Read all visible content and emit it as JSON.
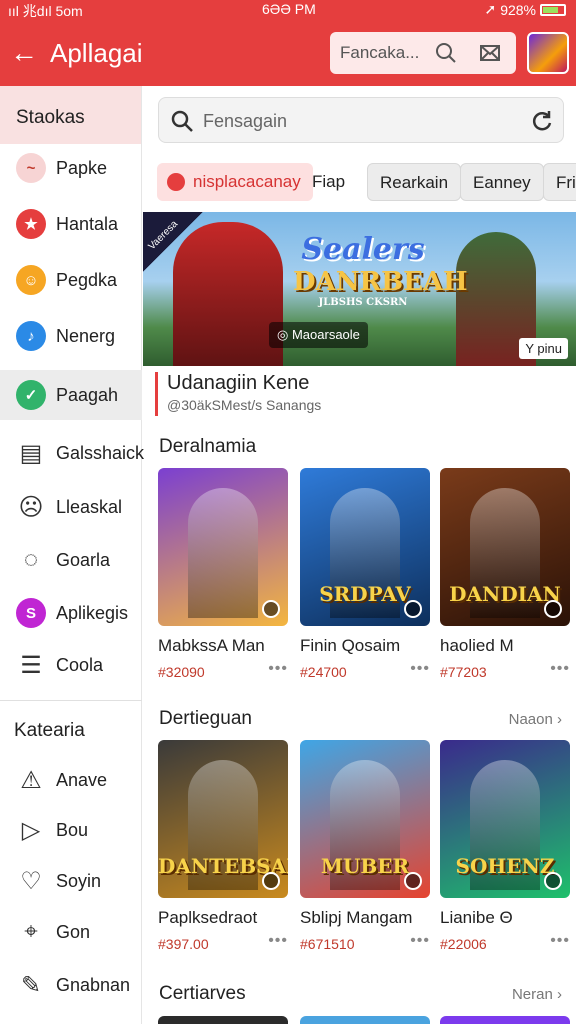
{
  "status_bar": {
    "left": "ııl 兆dıl 5om",
    "time": "6ƏƏ PM",
    "battery": "928%"
  },
  "header": {
    "title": "Apllagai",
    "search_text": "Fancaka..."
  },
  "sidebar": {
    "heading": "Staokas",
    "items": [
      {
        "label": "Papke",
        "icon": "swirl-icon",
        "color": "#f7d4d4",
        "glyph": "~"
      },
      {
        "label": "Hantala",
        "icon": "star-icon",
        "color": "#e53e3e",
        "glyph": "★"
      },
      {
        "label": "Pegdka",
        "icon": "face-icon",
        "color": "#f6a623",
        "glyph": "☺"
      },
      {
        "label": "Nenerg",
        "icon": "note-icon",
        "color": "#2b8ae6",
        "glyph": "♪"
      },
      {
        "label": "Paagah",
        "icon": "check-icon",
        "color": "#31b36b",
        "glyph": "✓"
      },
      {
        "label": "Galsshaick",
        "icon": "card-icon",
        "color": "",
        "glyph": "▤"
      },
      {
        "label": "Lleaskal",
        "icon": "smile-icon",
        "color": "",
        "glyph": "☹"
      },
      {
        "label": "Goarla",
        "icon": "chat-icon",
        "color": "",
        "glyph": "◌"
      },
      {
        "label": "Aplikegis",
        "icon": "app-icon",
        "color": "#c026d3",
        "glyph": "S"
      },
      {
        "label": "Coola",
        "icon": "list-icon",
        "color": "",
        "glyph": "☰"
      }
    ],
    "section2": "Katearia",
    "items2": [
      {
        "label": "Anave",
        "icon": "alert-icon",
        "glyph": "⚠"
      },
      {
        "label": "Bou",
        "icon": "play-icon",
        "glyph": "▷"
      },
      {
        "label": "Soyin",
        "icon": "heart-icon",
        "glyph": "♡"
      },
      {
        "label": "Gon",
        "icon": "pin-icon",
        "glyph": "⌖"
      },
      {
        "label": "Gnabnan",
        "icon": "edit-icon",
        "glyph": "✎"
      }
    ]
  },
  "search": {
    "placeholder": "Fensagain"
  },
  "chips": [
    "nisplacacanay",
    "Fiap",
    "Rearkain",
    "Eanney",
    "Fri"
  ],
  "banner": {
    "logo_line1": "Sealers",
    "logo_line2": "DANRBEAH",
    "logo_line3": "JLBSHS CKSRN",
    "tag": "Maoarsaole",
    "tag_right": "Y pinu",
    "ribbon": "Vaeresa"
  },
  "featured": {
    "title": "Udanagiin Kene",
    "subtitle": "@30äkSMest/s Sanangs"
  },
  "sections": [
    {
      "title": "Deralnamia",
      "more": "",
      "cards": [
        {
          "name": "MabkssA Man",
          "price": "#32090",
          "caption": "",
          "colors": [
            "#7b3fd1",
            "#f4b63f"
          ]
        },
        {
          "name": "Finin Qosaim",
          "price": "#24700",
          "caption": "SRDPAV",
          "colors": [
            "#2f7bd9",
            "#0d2f5c"
          ]
        },
        {
          "name": "haolied M",
          "price": "#77203",
          "caption": "DANDIAN",
          "colors": [
            "#7a3b1a",
            "#2b1207"
          ]
        }
      ]
    },
    {
      "title": "Dertieguan",
      "more": "Naaon ›",
      "cards": [
        {
          "name": "Paplksedraot",
          "price": "#397.00",
          "caption": "DANTEBSAN",
          "colors": [
            "#3a3a3a",
            "#c98a1e"
          ]
        },
        {
          "name": "Sblipj Mangam",
          "price": "#671510",
          "caption": "MUBER",
          "colors": [
            "#3fa6e6",
            "#e6432f"
          ]
        },
        {
          "name": "Lianibe Θ",
          "price": "#22006",
          "caption": "SOHENZ",
          "colors": [
            "#3a2a8c",
            "#1ec06b"
          ]
        }
      ]
    },
    {
      "title": "Certiarves",
      "more": "Neran ›"
    }
  ]
}
